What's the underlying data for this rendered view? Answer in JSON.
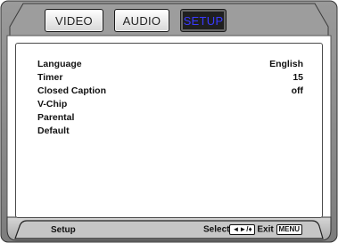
{
  "tabs": [
    {
      "label": "VIDEO",
      "active": false
    },
    {
      "label": "AUDIO",
      "active": false
    },
    {
      "label": "SETUP",
      "active": true
    }
  ],
  "menu": [
    {
      "label": "Language",
      "value": "English"
    },
    {
      "label": "Timer",
      "value": "15"
    },
    {
      "label": "Closed Caption",
      "value": "off"
    },
    {
      "label": "V-Chip",
      "value": ""
    },
    {
      "label": "Parental",
      "value": ""
    },
    {
      "label": "Default",
      "value": ""
    }
  ],
  "footer": {
    "title": "Setup",
    "select_label": "Select",
    "select_keys": "◄►/♦",
    "exit_label": "Exit",
    "exit_key": "MENU"
  },
  "colors": {
    "frame": "#8c8c8c",
    "active_tab_bg": "#1f1f1f",
    "active_tab_text": "#3a3aff",
    "footer_bar": "#bdbdbd"
  }
}
